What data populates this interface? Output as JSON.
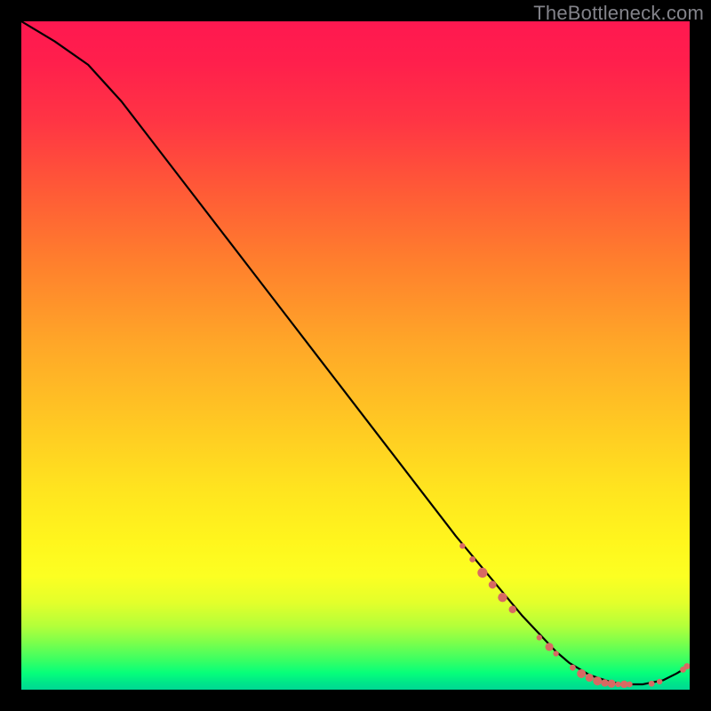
{
  "watermark": "TheBottleneck.com",
  "chart_data": {
    "type": "line",
    "title": "",
    "xlabel": "",
    "ylabel": "",
    "xlim": [
      0,
      100
    ],
    "ylim": [
      0,
      100
    ],
    "grid": false,
    "legend": false,
    "series": [
      {
        "name": "curve",
        "color": "#000000",
        "x": [
          0,
          5,
          10,
          15,
          20,
          25,
          30,
          35,
          40,
          45,
          50,
          55,
          60,
          65,
          70,
          75,
          80,
          82,
          85,
          88,
          90,
          93,
          96,
          98,
          100
        ],
        "y": [
          100,
          97,
          93.5,
          88,
          81.5,
          75,
          68.5,
          62,
          55.5,
          49,
          42.5,
          36,
          29.5,
          23,
          17,
          11,
          5.7,
          4,
          2.2,
          1.2,
          0.8,
          0.8,
          1.4,
          2.4,
          3.6
        ]
      }
    ],
    "markers": [
      {
        "name": "data-points",
        "color": "#d86a63",
        "points": [
          {
            "x": 66.0,
            "y": 21.5,
            "r": 3.2
          },
          {
            "x": 67.5,
            "y": 19.5,
            "r": 3.4
          },
          {
            "x": 69.0,
            "y": 17.5,
            "r": 5.6
          },
          {
            "x": 70.5,
            "y": 15.7,
            "r": 4.4
          },
          {
            "x": 72.0,
            "y": 13.8,
            "r": 5.2
          },
          {
            "x": 73.5,
            "y": 12.0,
            "r": 4.2
          },
          {
            "x": 77.5,
            "y": 7.8,
            "r": 3.2
          },
          {
            "x": 79.0,
            "y": 6.4,
            "r": 4.6
          },
          {
            "x": 80.0,
            "y": 5.4,
            "r": 3.2
          },
          {
            "x": 82.5,
            "y": 3.3,
            "r": 3.4
          },
          {
            "x": 83.8,
            "y": 2.4,
            "r": 5.0
          },
          {
            "x": 85.0,
            "y": 1.8,
            "r": 4.6
          },
          {
            "x": 86.2,
            "y": 1.3,
            "r": 5.0
          },
          {
            "x": 87.3,
            "y": 1.0,
            "r": 4.2
          },
          {
            "x": 88.3,
            "y": 0.9,
            "r": 4.6
          },
          {
            "x": 89.3,
            "y": 0.8,
            "r": 3.2
          },
          {
            "x": 90.2,
            "y": 0.8,
            "r": 4.2
          },
          {
            "x": 91.0,
            "y": 0.8,
            "r": 3.4
          },
          {
            "x": 94.3,
            "y": 0.9,
            "r": 3.4
          },
          {
            "x": 95.5,
            "y": 1.2,
            "r": 3.2
          },
          {
            "x": 99.0,
            "y": 3.0,
            "r": 3.4
          },
          {
            "x": 99.6,
            "y": 3.5,
            "r": 3.6
          }
        ]
      }
    ]
  }
}
